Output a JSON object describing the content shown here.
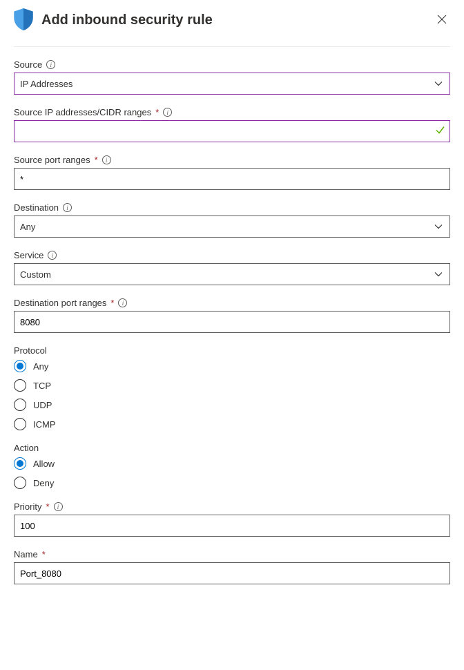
{
  "header": {
    "title": "Add inbound security rule"
  },
  "fields": {
    "source": {
      "label": "Source",
      "value": "IP Addresses"
    },
    "source_ip": {
      "label": "Source IP addresses/CIDR ranges",
      "value": ""
    },
    "source_port": {
      "label": "Source port ranges",
      "value": "*"
    },
    "destination": {
      "label": "Destination",
      "value": "Any"
    },
    "service": {
      "label": "Service",
      "value": "Custom"
    },
    "dest_port": {
      "label": "Destination port ranges",
      "value": "8080"
    },
    "protocol": {
      "label": "Protocol",
      "options": [
        "Any",
        "TCP",
        "UDP",
        "ICMP"
      ],
      "selected": "Any"
    },
    "action": {
      "label": "Action",
      "options": [
        "Allow",
        "Deny"
      ],
      "selected": "Allow"
    },
    "priority": {
      "label": "Priority",
      "value": "100"
    },
    "name": {
      "label": "Name",
      "value": "Port_8080"
    }
  }
}
